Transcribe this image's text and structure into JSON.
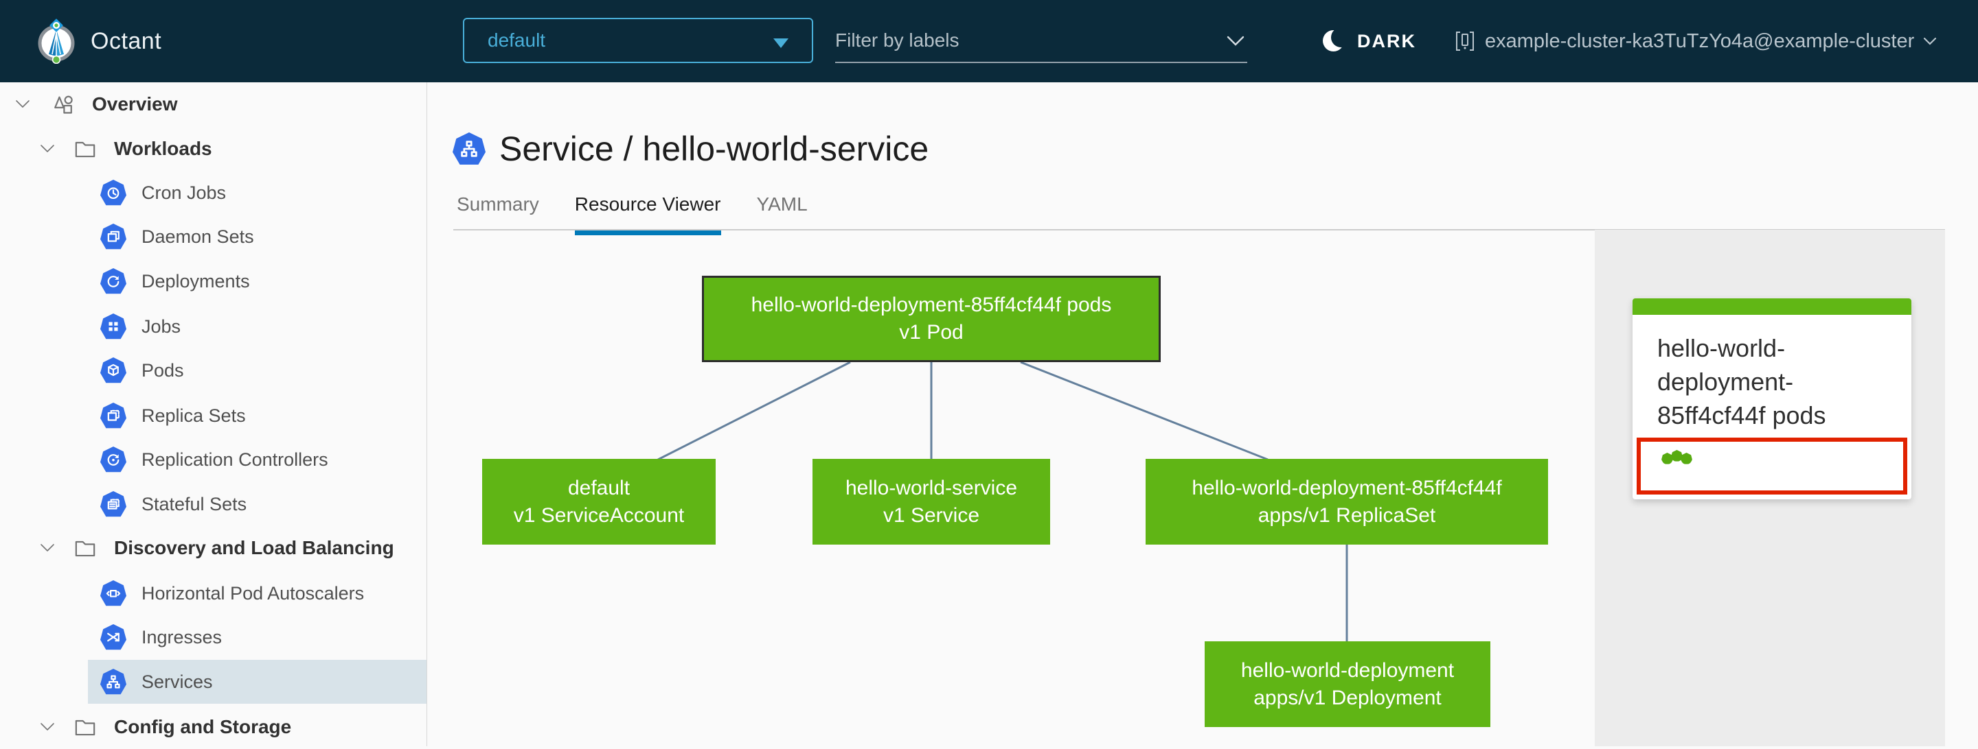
{
  "header": {
    "app_name": "Octant",
    "namespace_value": "default",
    "filter_placeholder": "Filter by labels",
    "theme_label": "DARK",
    "cluster_label": "example-cluster-ka3TuTzYo4a@example-cluster"
  },
  "sidebar": {
    "items": [
      {
        "label": "Overview",
        "level": 1,
        "icon": "overview-icon",
        "expanded": true
      },
      {
        "label": "Workloads",
        "level": 2,
        "icon": "folder-icon",
        "expanded": true
      },
      {
        "label": "Cron Jobs",
        "level": 3,
        "icon": "cron-jobs-icon"
      },
      {
        "label": "Daemon Sets",
        "level": 3,
        "icon": "daemon-sets-icon"
      },
      {
        "label": "Deployments",
        "level": 3,
        "icon": "deployments-icon"
      },
      {
        "label": "Jobs",
        "level": 3,
        "icon": "jobs-icon"
      },
      {
        "label": "Pods",
        "level": 3,
        "icon": "pods-icon"
      },
      {
        "label": "Replica Sets",
        "level": 3,
        "icon": "replica-sets-icon"
      },
      {
        "label": "Replication Controllers",
        "level": 3,
        "icon": "replication-controllers-icon"
      },
      {
        "label": "Stateful Sets",
        "level": 3,
        "icon": "stateful-sets-icon"
      },
      {
        "label": "Discovery and Load Balancing",
        "level": 2,
        "icon": "folder-icon",
        "expanded": true
      },
      {
        "label": "Horizontal Pod Autoscalers",
        "level": 3,
        "icon": "hpa-icon"
      },
      {
        "label": "Ingresses",
        "level": 3,
        "icon": "ingresses-icon"
      },
      {
        "label": "Services",
        "level": 3,
        "icon": "services-icon",
        "active": true
      },
      {
        "label": "Config and Storage",
        "level": 2,
        "icon": "folder-icon",
        "expanded": true
      }
    ]
  },
  "page": {
    "title": "Service / hello-world-service",
    "tabs": [
      {
        "label": "Summary",
        "active": false
      },
      {
        "label": "Resource Viewer",
        "active": true
      },
      {
        "label": "YAML",
        "active": false
      }
    ]
  },
  "graph": {
    "nodes": [
      {
        "id": "pod",
        "lines": [
          "hello-world-deployment-85ff4cf44f pods",
          "v1 Pod"
        ],
        "selected": true
      },
      {
        "id": "serviceaccount",
        "lines": [
          "default",
          "v1 ServiceAccount"
        ],
        "selected": false
      },
      {
        "id": "service",
        "lines": [
          "hello-world-service",
          "v1 Service"
        ],
        "selected": false
      },
      {
        "id": "replicaset",
        "lines": [
          "hello-world-deployment-85ff4cf44f",
          "apps/v1 ReplicaSet"
        ],
        "selected": false
      },
      {
        "id": "deployment",
        "lines": [
          "hello-world-deployment",
          "apps/v1 Deployment"
        ],
        "selected": false
      }
    ],
    "edges": [
      {
        "from": "pod",
        "to": "serviceaccount"
      },
      {
        "from": "pod",
        "to": "service"
      },
      {
        "from": "pod",
        "to": "replicaset"
      },
      {
        "from": "replicaset",
        "to": "deployment"
      }
    ]
  },
  "side_panel": {
    "card": {
      "title": "hello-world-deployment-85ff4cf44f pods",
      "status_dot_count": 3
    }
  },
  "colors": {
    "header_bg": "#0b2a3a",
    "accent_blue": "#49afd9",
    "k8s_icon_blue": "#326de6",
    "node_green": "#60b515",
    "tab_active_underline": "#0079b8",
    "selected_row_bg": "#d8e3e9",
    "edge_line": "#64809c",
    "alert_red": "#e12200",
    "panel_bg": "#ececec"
  }
}
